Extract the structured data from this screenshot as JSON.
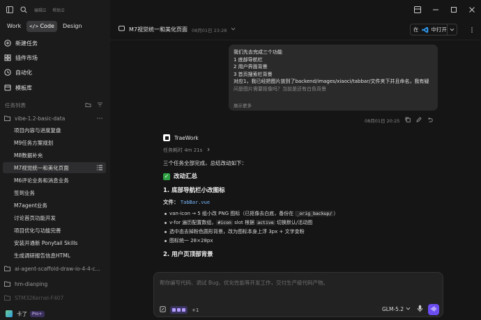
{
  "topbar": {
    "links": [
      "编辑☰",
      "帮助☰"
    ]
  },
  "mode_tabs": [
    {
      "label": "Work",
      "icon": ""
    },
    {
      "label": "Code",
      "icon": "code-icon",
      "active": true
    },
    {
      "label": "Design",
      "icon": ""
    }
  ],
  "nav": [
    {
      "label": "新建任务",
      "icon": "plus-circle-icon"
    },
    {
      "label": "插件市场",
      "icon": "grid-icon"
    },
    {
      "label": "自动化",
      "icon": "clock-icon"
    },
    {
      "label": "模板库",
      "icon": "template-icon"
    }
  ],
  "task_list": {
    "title": "任务列表",
    "folders": [
      {
        "name": "vibe-1.2-basic-data",
        "tasks": [
          "项目内容与进度复盘",
          "M9任务方案规划",
          "M8数据补充",
          "M7视觉统一和美化页面",
          "M6评论业务和消息业务",
          "签到业务",
          "M7agent业务",
          "讨论首页功能开发",
          "项目优化与功能完善",
          "安装开通新 Ponytail Skills",
          "生成调研报告信息HTML"
        ],
        "active_index": 3
      },
      {
        "name": "ai-agent-scaffold-draw-io-4-4-c...",
        "tasks": []
      },
      {
        "name": "hm-dianping",
        "tasks": []
      },
      {
        "name": "STM32Kernel-F407",
        "tasks": []
      }
    ]
  },
  "user": {
    "name": "卡了",
    "badge": "Pro+"
  },
  "header": {
    "title": "M7视觉统一和美化页面",
    "time": "08月01日 23:28",
    "open_prefix": "在",
    "open_label": "中打开"
  },
  "user_message": {
    "lines": [
      "我们先去完成三个功能",
      "1 底部导航栏",
      "2 用户界面背景",
      "3 首页搜索栏背景",
      "对应1，我已经把图片放到了backend/images/xiaoci/tabbar/文件夹下并且命名，我有疑",
      "问是图片需要抠像吗？当前是还有白色背景"
    ],
    "show_more": "展示更多",
    "time": "08月01日 20:25"
  },
  "assistant": {
    "name": "TraeWork",
    "duration": "任务耗时 4m 21s",
    "intro": "三个任务全部完成，总结改动如下：",
    "summary_heading": "改动汇总",
    "section1_heading": "1. 底部导航栏小改图标",
    "file_label": "文件：",
    "file_name": "TabBar.vue",
    "bullets": [
      [
        "van-icon → 5 组小改 PNG 图标（已抠像去白底，备份在 ",
        "_orig_backup/",
        "）"
      ],
      [
        "v-for 遍历配置数组，",
        "#icon",
        " slot 根据 ",
        "active",
        " 切换默认/活动图"
      ],
      [
        "选中态去掉粉色圆形背景，改为图标本身上浮 3px + 文字变粉",
        "",
        ""
      ],
      [
        "图标统一 28×28px",
        "",
        ""
      ]
    ],
    "section2_heading": "2. 用户页顶部背景"
  },
  "composer": {
    "placeholder": "帮你编写代码、调试 Bug、优化性能等开发工作，交付生产级代码产物。",
    "extra_count": "+1",
    "model": "GLM-5.2"
  },
  "colors": {
    "accent": "#6b4df0",
    "sidebar_bg": "#1b1b1c",
    "main_bg": "#151515",
    "code_blue": "#79b8ff",
    "check_green": "#2ea043"
  }
}
